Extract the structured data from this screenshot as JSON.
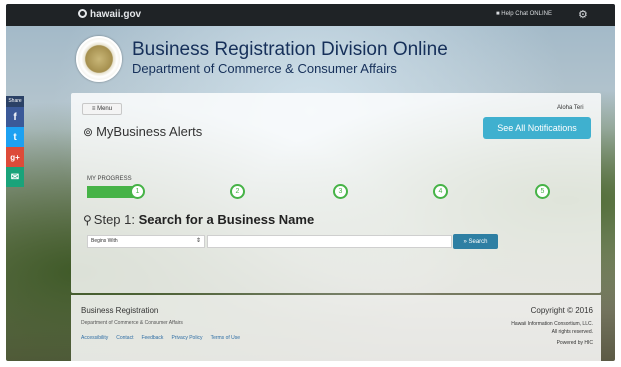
{
  "topbar": {
    "logo_text": "hawaii.gov",
    "help_text": "■ Help Chat ONLINE",
    "gear_icon": "gear-icon"
  },
  "header": {
    "title": "Business Registration Division Online",
    "subtitle": "Department of Commerce & Consumer Affairs"
  },
  "share": {
    "label": "Share",
    "facebook": "f",
    "twitter": "t",
    "googleplus": "g+",
    "email": "✉"
  },
  "panel": {
    "menu_label": "≡ Menu",
    "user_name": "Aloha Teri",
    "alerts_title": "MyBusiness Alerts",
    "notifications_button": "See All Notifications",
    "progress_label": "MY PROGRESS",
    "progress_fraction": 0.2,
    "steps": [
      "1",
      "2",
      "3",
      "4",
      "5"
    ],
    "step_prefix": "Step 1:",
    "step_title": "Search for a Business Name",
    "select_value": "Begins With",
    "search_placeholder": "",
    "search_button": "» Search"
  },
  "footer": {
    "title": "Business Registration",
    "subtitle": "Department of Commerce & Consumer Affairs",
    "links": [
      "Accessibility",
      "Contact",
      "Feedback",
      "Privacy Policy",
      "Terms of Use"
    ],
    "copyright": "Copyright © 2016",
    "company": "Hawaii Information Consortium, LLC.",
    "rights": "All rights reserved.",
    "powered": "Powered by HIC"
  },
  "colors": {
    "accent": "#3fb0cf",
    "progress": "#46b347",
    "brand_text": "#16305a"
  }
}
